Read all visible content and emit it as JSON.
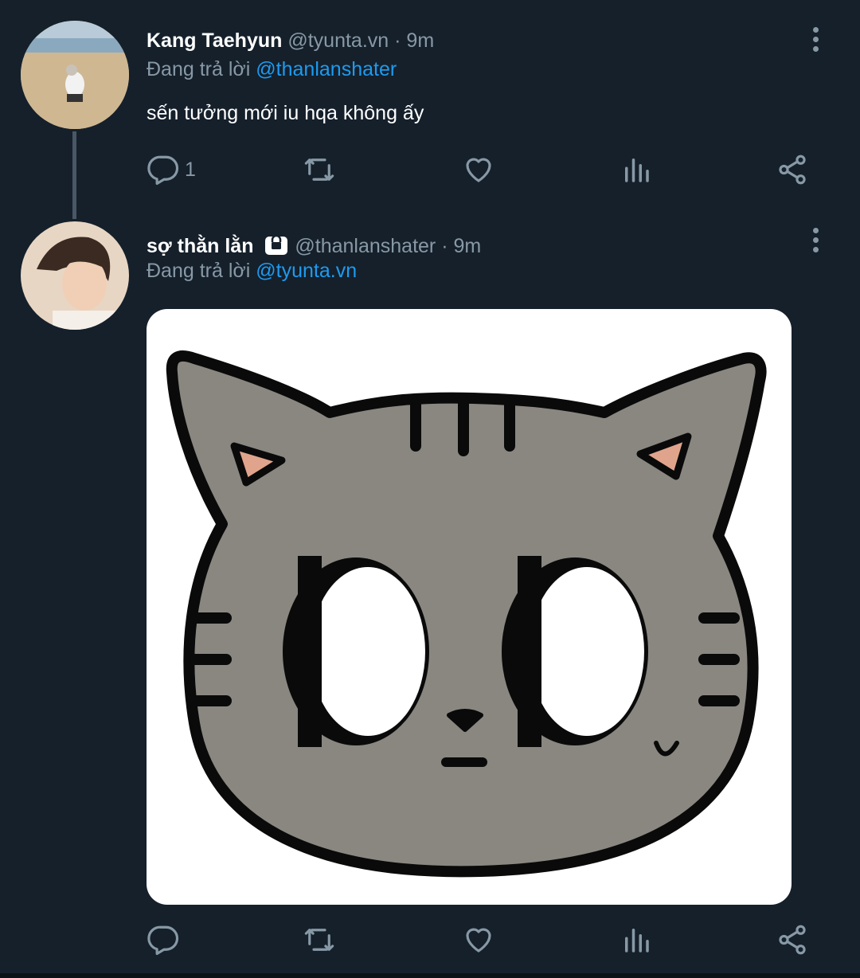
{
  "tweets": [
    {
      "name": "Kang Taehyun",
      "handle": "@tyunta.vn",
      "time": "· 9m",
      "reply_prefix": "Đang trả lời",
      "reply_to": "@thanlanshater",
      "text": "sến tưởng mới iu hqa không ấy",
      "reply_count": "1",
      "retweet_count": "",
      "like_count": ""
    },
    {
      "name": "sợ thằn lằn",
      "handle": "@thanlanshater",
      "time": "· 9m",
      "reply_prefix": "Đang trả lời",
      "reply_to": "@tyunta.vn",
      "text": "",
      "reply_count": "",
      "retweet_count": "",
      "like_count": "",
      "protected": true,
      "media": "cat-illustration"
    }
  ],
  "colors": {
    "background": "#15202b",
    "muted": "#8899a6",
    "link": "#1d9bf0",
    "cat_gray": "#8a8781",
    "ear_pink": "#e0a48c"
  },
  "icons": [
    "reply-icon",
    "retweet-icon",
    "like-icon",
    "analytics-icon",
    "share-icon",
    "more-icon",
    "lock-icon"
  ]
}
